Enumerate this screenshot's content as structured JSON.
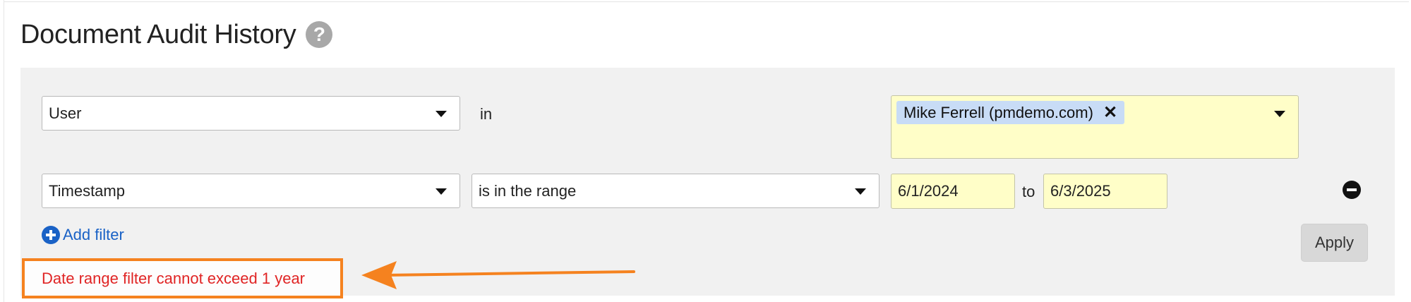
{
  "header": {
    "title": "Document Audit History",
    "help_icon": "question-circle-icon"
  },
  "filters": [
    {
      "field": "User",
      "operator": "in",
      "values": [
        "Mike Ferrell (pmdemo.com)"
      ]
    },
    {
      "field": "Timestamp",
      "operator": "is in the range",
      "from": "6/1/2024",
      "range_separator": "to",
      "to": "6/3/2025"
    }
  ],
  "actions": {
    "add_filter_label": "Add filter",
    "apply_label": "Apply"
  },
  "error": {
    "message": "Date range filter cannot exceed 1 year"
  },
  "colors": {
    "accent_blue": "#1a62c6",
    "value_highlight": "#fffec8",
    "chip_bg": "#c8dcf6",
    "error_text": "#e02424",
    "annotation_orange": "#f5821f"
  }
}
